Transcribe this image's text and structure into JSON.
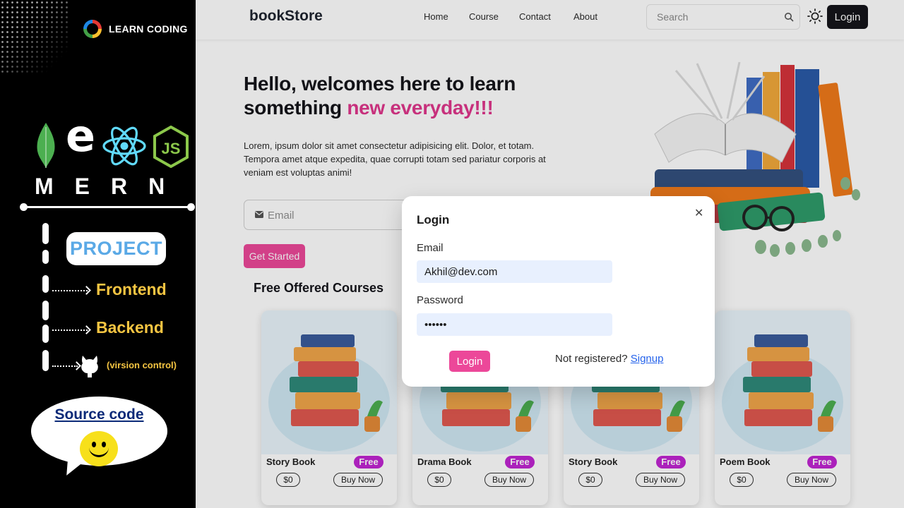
{
  "promo": {
    "brand_text": "LEARN CODING",
    "stack_word": "MERN",
    "badge": "PROJECT",
    "steps": [
      "Frontend",
      "Backend"
    ],
    "vcs_note": "(virsion control)",
    "source_label": "Source code",
    "colors": {
      "yellow": "#f5c542",
      "badge_text": "#5aa9e6"
    }
  },
  "navbar": {
    "brand": "bookStore",
    "links": [
      "Home",
      "Course",
      "Contact",
      "About"
    ],
    "search_placeholder": "Search",
    "login_label": "Login",
    "icons": [
      "search-icon",
      "sun-theme-icon"
    ]
  },
  "hero": {
    "title_line1": "Hello, welcomes here to learn",
    "title_line2_prefix": "something ",
    "title_highlight": "new everyday!!!",
    "paragraph": "Lorem, ipsum dolor sit amet consectetur adipisicing elit. Dolor, et totam. Tempora amet atque expedita, quae corrupti totam sed pariatur corporis at veniam est voluptas animi!",
    "email_placeholder": "Email",
    "cta": "Get Started",
    "accent": "#ec4899"
  },
  "courses": {
    "heading": "Free Offered Courses",
    "items": [
      {
        "name": "Story Book",
        "badge": "Free",
        "price": "$0",
        "action": "Buy Now"
      },
      {
        "name": "Drama Book",
        "badge": "Free",
        "price": "$0",
        "action": "Buy Now"
      },
      {
        "name": "Story Book",
        "badge": "Free",
        "price": "$0",
        "action": "Buy Now"
      },
      {
        "name": "Poem Book",
        "badge": "Free",
        "price": "$0",
        "action": "Buy Now"
      }
    ]
  },
  "modal": {
    "title": "Login",
    "close": "✕",
    "email_label": "Email",
    "email_value": "Akhil@dev.com",
    "password_label": "Password",
    "password_value": "••••••",
    "submit": "Login",
    "register_prompt": "Not registered? ",
    "register_link": "Signup"
  }
}
